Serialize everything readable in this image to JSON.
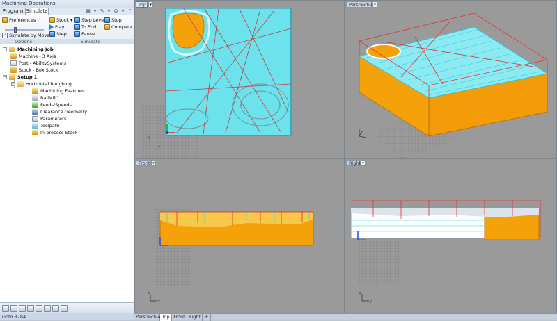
{
  "panel": {
    "title": "Machining Operations"
  },
  "ribbon": {
    "tabs": [
      {
        "label": "Program",
        "active": false
      },
      {
        "label": "Simulate",
        "active": true
      }
    ],
    "options": {
      "preferences_label": "Preferences",
      "simulate_by_moves_label": "Simulate by Moves",
      "simulate_by_moves_checked": true,
      "group_label": "Options"
    },
    "simulate": {
      "stock_label": "Stock",
      "play_label": "Play",
      "step_label": "Step",
      "step_levels_label": "Step Levels",
      "to_end_label": "To End",
      "pause_label": "Pause",
      "stop_label": "Stop",
      "compare_label": "Compare",
      "group_label": "Simulate"
    }
  },
  "tree": {
    "job": "Machining Job",
    "machine": "Machine - 3 Axis",
    "post": "Post - AbilitySystems",
    "stock": "Stock - Box Stock",
    "setup": "Setup 1",
    "operation": "Horizontal Roughing",
    "children": [
      "Machining Features",
      "BallMill1",
      "Feeds/Speeds",
      "Clearance Geometry",
      "Parameters",
      "Toolpath",
      "In-process Stock"
    ]
  },
  "status": {
    "text": "Goto 8784"
  },
  "viewports": {
    "top": {
      "title": "Top"
    },
    "perspective": {
      "title": "Perspective"
    },
    "front": {
      "title": "Front"
    },
    "right": {
      "title": "Right"
    }
  },
  "viewport_tabs": [
    "Perspective",
    "Top",
    "Front",
    "Right"
  ],
  "viewport_tabs_active": "Top",
  "add_tab_symbol": "+",
  "axis_labels": {
    "x": "x",
    "y": "y",
    "z": "z"
  },
  "colors": {
    "viewport_bg": "#9a9a9a",
    "toolpath": "#22d8e8",
    "stock": "#f5a10a",
    "rapid": "#e03030",
    "grid": "#7a7a7a"
  }
}
